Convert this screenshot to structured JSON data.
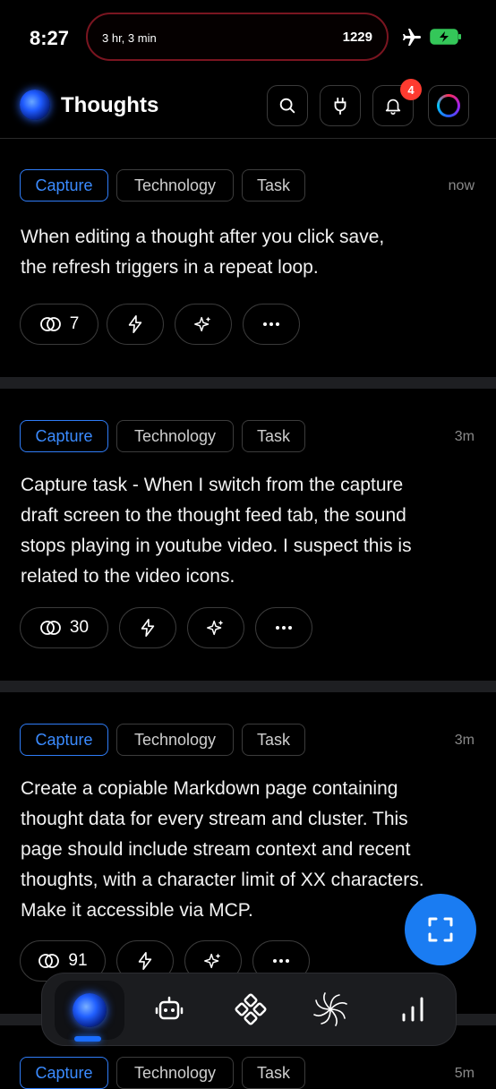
{
  "status": {
    "time": "8:27",
    "activity_duration": "3 hr, 3 min",
    "activity_value": "1229",
    "battery_color": "#34c759",
    "island_border_color": "#7a1520"
  },
  "header": {
    "title": "Thoughts",
    "notification_count": "4",
    "icons": [
      "search-icon",
      "plug-icon",
      "bell-icon",
      "avatar"
    ]
  },
  "tags": {
    "capture": "Capture",
    "technology": "Technology",
    "task": "Task"
  },
  "thoughts": [
    {
      "timestamp": "now",
      "lines": [
        "When editing a thought after you click save,",
        "the refresh triggers in a repeat loop."
      ],
      "link_count": "7"
    },
    {
      "timestamp": "3m",
      "lines": [
        "Capture task - When I switch from the capture",
        "draft screen to the thought feed tab, the sound",
        "stops playing in youtube video.  I suspect this is",
        "related to the video icons."
      ],
      "link_count": "30"
    },
    {
      "timestamp": "3m",
      "lines": [
        "Create a copiable Markdown page containing",
        "thought data for every stream and cluster. This",
        "page should include stream context and recent",
        "thoughts, with a character limit of XX characters.",
        "Make it accessible via MCP."
      ],
      "link_count": "91"
    },
    {
      "timestamp": "5m"
    }
  ],
  "colors": {
    "accent": "#1a7cf2",
    "capture_tag": "#3b8bff",
    "badge": "#ff3b30",
    "separator": "#1e1f22"
  },
  "bottom_nav": {
    "items": [
      "orb-icon",
      "robot-icon",
      "nodes-icon",
      "spiral-icon",
      "bar-chart-icon"
    ],
    "active_index": 0
  }
}
